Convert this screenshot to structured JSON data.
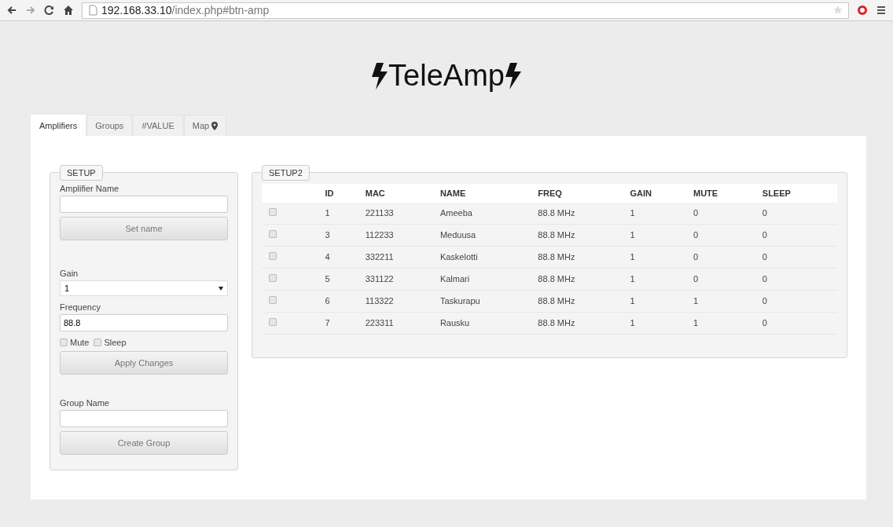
{
  "browser": {
    "url_host": "192.168.33.10",
    "url_path": "/index.php#btn-amp",
    "bookmarked": false
  },
  "title": "TeleAmp",
  "tabs": [
    {
      "label": "Amplifiers",
      "selected": true,
      "kind": "text"
    },
    {
      "label": "Groups",
      "selected": false,
      "kind": "text"
    },
    {
      "label": "#VALUE",
      "selected": false,
      "kind": "text"
    },
    {
      "label": "Map",
      "selected": false,
      "kind": "map"
    }
  ],
  "setup": {
    "legend": "SETUP",
    "amp_name_label": "Amplifier Name",
    "set_name_button": "Set name",
    "gain_label": "Gain",
    "gain_value": "1",
    "frequency_label": "Frequency",
    "frequency_value": "88.8",
    "checks": [
      {
        "label": "Mute",
        "checked": false
      },
      {
        "label": "Sleep",
        "checked": false
      }
    ],
    "apply_button": "Apply Changes",
    "group_name_label": "Group Name",
    "create_group_button": "Create Group"
  },
  "setup2": {
    "legend": "SETUP2",
    "columns": [
      "ID",
      "MAC",
      "NAME",
      "FREQ",
      "GAIN",
      "MUTE",
      "SLEEP"
    ],
    "rows": [
      {
        "checked": false,
        "cells": [
          "1",
          "221133",
          "Ameeba",
          "88.8 MHz",
          "1",
          "0",
          "0"
        ]
      },
      {
        "checked": false,
        "cells": [
          "3",
          "112233",
          "Meduusa",
          "88.8 MHz",
          "1",
          "0",
          "0"
        ]
      },
      {
        "checked": false,
        "cells": [
          "4",
          "332211",
          "Kaskelotti",
          "88.8 MHz",
          "1",
          "0",
          "0"
        ]
      },
      {
        "checked": false,
        "cells": [
          "5",
          "331122",
          "Kalmari",
          "88.8 MHz",
          "1",
          "0",
          "0"
        ]
      },
      {
        "checked": false,
        "cells": [
          "6",
          "113322",
          "Taskurapu",
          "88.8 MHz",
          "1",
          "1",
          "0"
        ]
      },
      {
        "checked": false,
        "cells": [
          "7",
          "223311",
          "Rausku",
          "88.8 MHz",
          "1",
          "1",
          "0"
        ]
      }
    ]
  }
}
